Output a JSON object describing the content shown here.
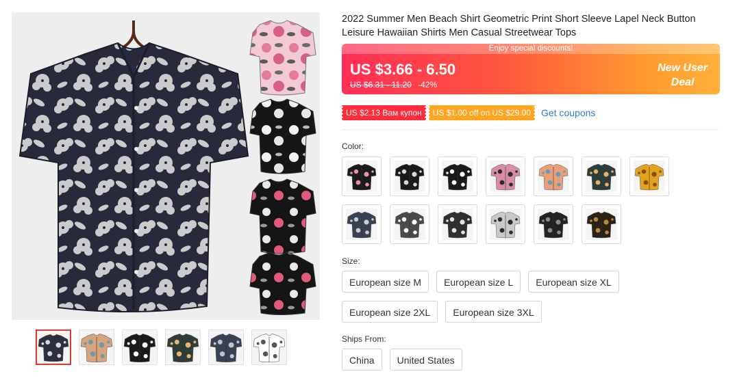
{
  "product": {
    "title": "2022 Summer Men Beach Shirt Geometric Print Short Sleeve Lapel Neck Button Leisure Hawaiian Shirts Men Casual Streetwear Tops"
  },
  "price": {
    "banner_text": "Enjoy special discounts!",
    "range": "US $3.66 - 6.50",
    "original": "US $6.31 - 11.20",
    "discount": "-42%",
    "deal_line1": "New User",
    "deal_line2": "Deal"
  },
  "coupons": {
    "coupon1": "US $2.13 Вам купон",
    "coupon2": "US $1.00 off on US $29.00",
    "link": "Get coupons"
  },
  "options": {
    "color_label": "Color:",
    "size_label": "Size:",
    "ships_label": "Ships From:",
    "sizes": [
      "European size M",
      "European size L",
      "European size XL",
      "European size 2XL",
      "European size 3XL"
    ],
    "ships_from": [
      "China",
      "United States"
    ]
  },
  "colors": {
    "accent_red": "#e03a2e",
    "link_blue": "#2e7bcf",
    "coupon_red": "#ff2d3c",
    "coupon_orange": "#ffa51f",
    "swatches": [
      {
        "bg": "#1a1a1a",
        "fg": "#e98fb0"
      },
      {
        "bg": "#1a1a1a",
        "fg": "#d8d8d8"
      },
      {
        "bg": "#1a1a1a",
        "fg": "#ffffff"
      },
      {
        "bg": "#d98ca6",
        "fg": "#2b2b2b"
      },
      {
        "bg": "#e7a07a",
        "fg": "#6a9bb5"
      },
      {
        "bg": "#2d3e3a",
        "fg": "#e8b06a"
      },
      {
        "bg": "#e2a41e",
        "fg": "#8a4f10"
      },
      {
        "bg": "#3a4152",
        "fg": "#c9ccd6"
      },
      {
        "bg": "#4a4a4a",
        "fg": "#ffffff"
      },
      {
        "bg": "#2f2f2f",
        "fg": "#e4e4e4"
      },
      {
        "bg": "#c9c9c9",
        "fg": "#2a2a2a"
      },
      {
        "bg": "#222222",
        "fg": "#8a8a8a"
      },
      {
        "bg": "#2b2215",
        "fg": "#b58a3d"
      }
    ],
    "thumbs": [
      {
        "bg": "#2b3040",
        "fg": "#d8d8d8"
      },
      {
        "bg": "#d9a37f",
        "fg": "#6f98a8"
      },
      {
        "bg": "#1a1a1a",
        "fg": "#ffffff"
      },
      {
        "bg": "#2d3e3a",
        "fg": "#e9b46d"
      },
      {
        "bg": "#3a4152",
        "fg": "#bfc4d2"
      },
      {
        "bg": "#ffffff",
        "fg": "#555555"
      }
    ]
  },
  "icons": {
    "main_image": "shirt-image",
    "swatch_image": "shirt-swatch-image"
  }
}
